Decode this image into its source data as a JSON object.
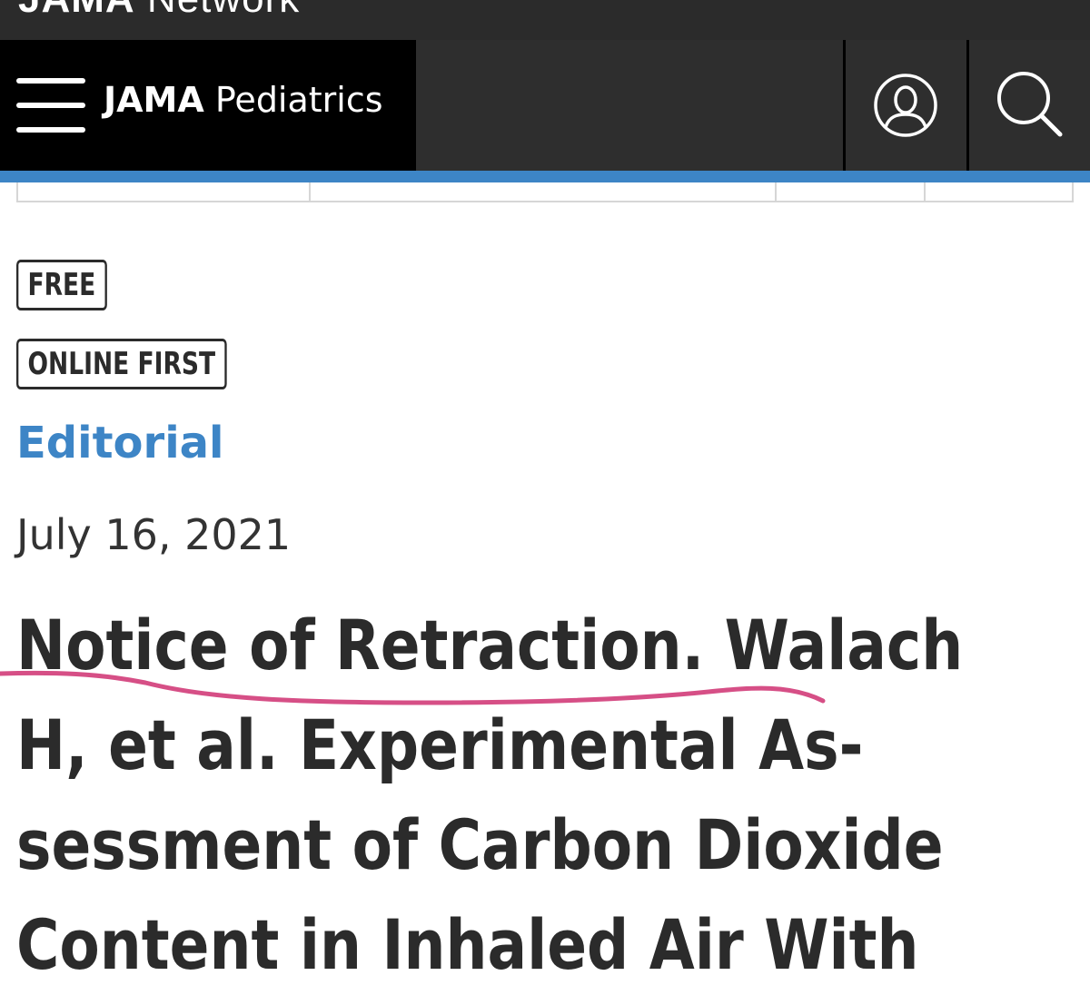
{
  "network_logo": {
    "brand": "JAMA",
    "suffix": "Network"
  },
  "header": {
    "journal_prefix": "JAMA",
    "journal_name": "Pediatrics",
    "menu_icon": "hamburger-icon",
    "account_icon": "user-icon",
    "search_icon": "search-icon"
  },
  "colors": {
    "accent": "#3d85c6",
    "header_bg": "#000000",
    "text_dark": "#2b2b2b",
    "annotation": "#d64f86"
  },
  "article": {
    "badges": [
      "FREE",
      "ONLINE FIRST"
    ],
    "category": "Editorial",
    "date": "July 16, 2021",
    "title_lines": [
      "Notice of Retraction. Walach",
      "H, et al. Experimental As-",
      "sessment of Carbon Dioxide",
      "Content in Inhaled Air With"
    ]
  }
}
